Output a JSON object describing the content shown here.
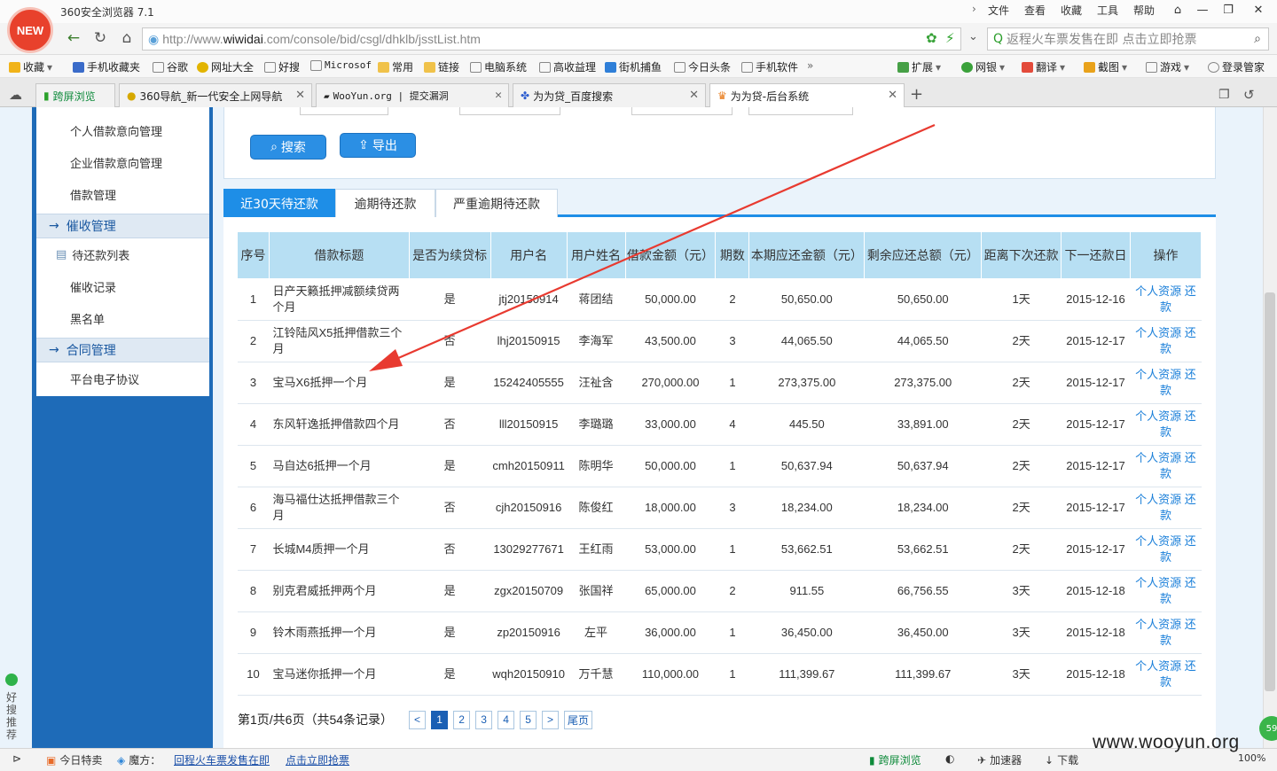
{
  "browser": {
    "logo_text": "NEW",
    "title": "360安全浏览器 7.1",
    "menu": [
      "文件",
      "查看",
      "收藏",
      "工具",
      "帮助"
    ],
    "url_prefix": "http://www.",
    "url_host": "wiwidai",
    "url_rest": ".com/console/bid/csgl/dhklb/jsstList.htm",
    "search_text": "返程火车票发售在即 点击立即抢票",
    "bookmarks": [
      "收藏",
      "手机收藏夹",
      "谷歌",
      "网址大全",
      "好搜",
      "Microsof",
      "常用",
      "链接",
      "电脑系统",
      "高收益理",
      "街机捕鱼",
      "今日头条",
      "手机软件"
    ],
    "bookmarks_right": [
      "扩展",
      "网银",
      "翻译",
      "截图",
      "游戏",
      "登录管家"
    ],
    "tabs": [
      {
        "label": "跨屏浏览"
      },
      {
        "label": "360导航_新一代安全上网导航"
      },
      {
        "label": "WooYun.org | 提交漏洞"
      },
      {
        "label": "为为贷_百度搜索"
      },
      {
        "label": "为为贷-后台系统"
      }
    ]
  },
  "sidebar": {
    "items_top": [
      "个人借款意向管理",
      "企业借款意向管理",
      "借款管理"
    ],
    "section1": "催收管理",
    "items_mid": [
      "待还款列表",
      "催收记录",
      "黑名单"
    ],
    "section2": "合同管理",
    "items_bottom": [
      "平台电子协议"
    ]
  },
  "toolbar": {
    "search_label": "搜索",
    "export_label": "导出"
  },
  "page_tabs": [
    "近30天待还款",
    "逾期待还款",
    "严重逾期待还款"
  ],
  "table": {
    "headers": [
      "序号",
      "借款标题",
      "是否为续贷标",
      "用户名",
      "用户姓名",
      "借款金额（元）",
      "期数",
      "本期应还金额（元）",
      "剩余应还总额（元）",
      "距离下次还款",
      "下一还款日",
      "操作"
    ],
    "rows": [
      [
        "1",
        "日产天籁抵押减额续贷两个月",
        "是",
        "jtj20150914",
        "蒋团结",
        "50,000.00",
        "2",
        "50,650.00",
        "50,650.00",
        "1天",
        "2015-12-16",
        "个人资源 还款"
      ],
      [
        "2",
        "江铃陆风X5抵押借款三个月",
        "否",
        "lhj20150915",
        "李海军",
        "43,500.00",
        "3",
        "44,065.50",
        "44,065.50",
        "2天",
        "2015-12-17",
        "个人资源 还款"
      ],
      [
        "3",
        "宝马X6抵押一个月",
        "是",
        "15242405555",
        "汪祉含",
        "270,000.00",
        "1",
        "273,375.00",
        "273,375.00",
        "2天",
        "2015-12-17",
        "个人资源 还款"
      ],
      [
        "4",
        "东风轩逸抵押借款四个月",
        "否",
        "lll20150915",
        "李璐璐",
        "33,000.00",
        "4",
        "445.50",
        "33,891.00",
        "2天",
        "2015-12-17",
        "个人资源 还款"
      ],
      [
        "5",
        "马自达6抵押一个月",
        "是",
        "cmh20150911",
        "陈明华",
        "50,000.00",
        "1",
        "50,637.94",
        "50,637.94",
        "2天",
        "2015-12-17",
        "个人资源 还款"
      ],
      [
        "6",
        "海马福仕达抵押借款三个月",
        "否",
        "cjh20150916",
        "陈俊红",
        "18,000.00",
        "3",
        "18,234.00",
        "18,234.00",
        "2天",
        "2015-12-17",
        "个人资源 还款"
      ],
      [
        "7",
        "长城M4质押一个月",
        "否",
        "13029277671",
        "王红雨",
        "53,000.00",
        "1",
        "53,662.51",
        "53,662.51",
        "2天",
        "2015-12-17",
        "个人资源 还款"
      ],
      [
        "8",
        "别克君威抵押两个月",
        "是",
        "zgx20150709",
        "张国祥",
        "65,000.00",
        "2",
        "911.55",
        "66,756.55",
        "3天",
        "2015-12-18",
        "个人资源 还款"
      ],
      [
        "9",
        "铃木雨燕抵押一个月",
        "是",
        "zp20150916",
        "左平",
        "36,000.00",
        "1",
        "36,450.00",
        "36,450.00",
        "3天",
        "2015-12-18",
        "个人资源 还款"
      ],
      [
        "10",
        "宝马迷你抵押一个月",
        "是",
        "wqh20150910",
        "万千慧",
        "110,000.00",
        "1",
        "111,399.67",
        "111,399.67",
        "3天",
        "2015-12-18",
        "个人资源 还款"
      ]
    ]
  },
  "pager": {
    "info": "第1页/共6页（共54条记录）",
    "prev": "<",
    "pages": [
      "1",
      "2",
      "3",
      "4",
      "5"
    ],
    "next": ">",
    "last": "尾页"
  },
  "statusbar": {
    "today": "今日特卖",
    "magic": "魔方：",
    "link1": "回程火车票发售在即",
    "link2": "点击立即抢票",
    "right": [
      "跨屏浏览",
      "加速器",
      "下载"
    ],
    "zoom": "100%",
    "badge": "59"
  },
  "side_float": "好搜推荐",
  "watermark": "www.wooyun.org",
  "colors": {
    "accent": "#1e8ee7",
    "sidebar": "#1e6bb8",
    "header_bg": "#b7dff3",
    "arrow": "#e83a30",
    "link": "#1a7fd9"
  }
}
